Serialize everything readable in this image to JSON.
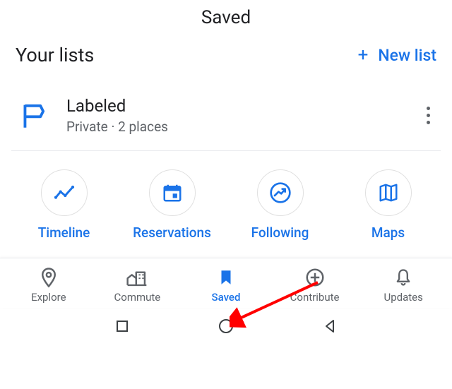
{
  "header": {
    "title": "Saved"
  },
  "section": {
    "your_lists": "Your lists",
    "new_list_label": "New list"
  },
  "list": {
    "name": "Labeled",
    "subtitle": "Private · 2 places"
  },
  "circles": {
    "timeline": "Timeline",
    "reservations": "Reservations",
    "following": "Following",
    "maps": "Maps"
  },
  "tabs": {
    "explore": "Explore",
    "commute": "Commute",
    "saved": "Saved",
    "contribute": "Contribute",
    "updates": "Updates"
  },
  "colors": {
    "blue": "#1a73e8",
    "gray": "#5f6368"
  }
}
